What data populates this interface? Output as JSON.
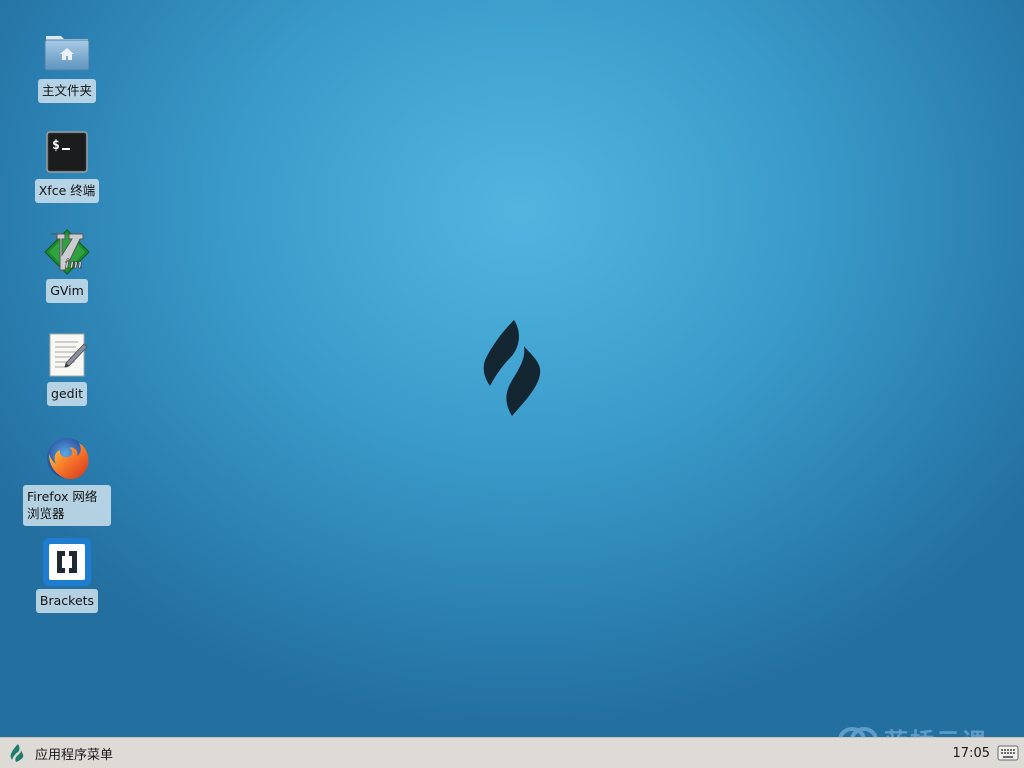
{
  "desktop": {
    "icons": [
      {
        "id": "home",
        "label": "主文件夹",
        "icon": "home-folder-icon"
      },
      {
        "id": "terminal",
        "label": "Xfce 终端",
        "icon": "terminal-icon"
      },
      {
        "id": "gvim",
        "label": "GVim",
        "icon": "gvim-icon"
      },
      {
        "id": "gedit",
        "label": "gedit",
        "icon": "gedit-icon"
      },
      {
        "id": "firefox",
        "label": "Firefox 网络浏览器",
        "icon": "firefox-icon"
      },
      {
        "id": "brackets",
        "label": "Brackets",
        "icon": "brackets-icon"
      }
    ],
    "colors": {
      "background_center": "#52b5e0",
      "background_edge": "#236f9f",
      "logo": "#152633"
    }
  },
  "panel": {
    "app_menu_label": "应用程序菜单",
    "clock": "17:05"
  },
  "watermark": {
    "text": "蓝桥云课"
  }
}
